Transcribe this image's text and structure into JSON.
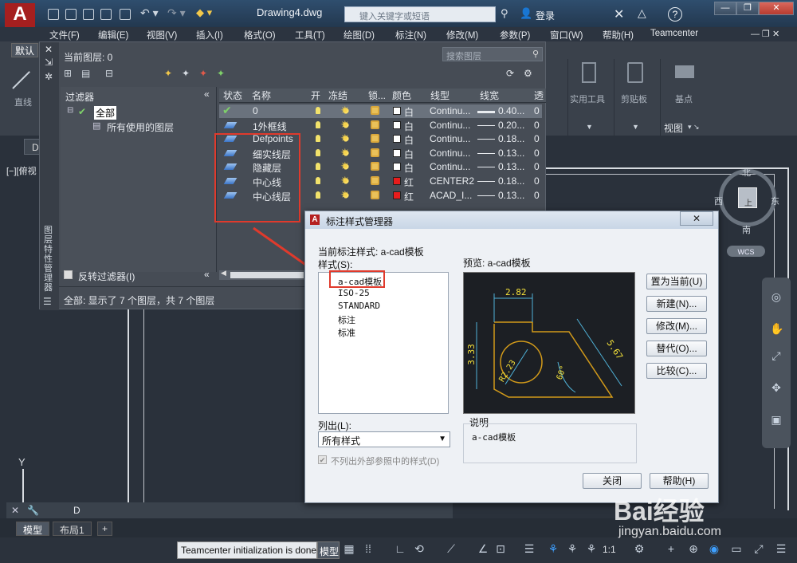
{
  "app": {
    "title": "Drawing4.dwg",
    "search_placeholder": "键入关键字或短语",
    "login": "登录",
    "help": "?"
  },
  "menu": [
    "文件(F)",
    "编辑(E)",
    "视图(V)",
    "插入(I)",
    "格式(O)",
    "工具(T)",
    "绘图(D)",
    "标注(N)",
    "修改(M)",
    "参数(P)",
    "窗口(W)",
    "帮助(H)",
    "Teamcenter"
  ],
  "ribbon": {
    "tab_default": "默认",
    "left_label": "直线",
    "panels": [
      "实用工具",
      "剪贴板",
      "基点"
    ],
    "view_label": "视图",
    "viewport_label": "[−][俯视",
    "d_tab": "D"
  },
  "layer_manager": {
    "current_layer": "当前图层: 0",
    "search_placeholder": "搜索图层",
    "filters_title": "过滤器",
    "filter_all": "全部",
    "filter_used": "所有使用的图层",
    "invert_filter": "反转过滤器(I)",
    "side_title": "图层特性管理器",
    "status_text": "全部: 显示了 7 个图层，共 7 个图层",
    "columns": [
      "状态",
      "名称",
      "开",
      "冻结",
      "锁...",
      "颜色",
      "线型",
      "线宽",
      "透"
    ],
    "rows": [
      {
        "name": "0",
        "color": "白",
        "color_hex": "#ffffff",
        "linetype": "Continu...",
        "lineweight": "0.40...",
        "trans": "0",
        "current": true
      },
      {
        "name": "1外框线",
        "color": "白",
        "color_hex": "#ffffff",
        "linetype": "Continu...",
        "lineweight": "0.20...",
        "trans": "0",
        "current": false
      },
      {
        "name": "Defpoints",
        "color": "白",
        "color_hex": "#ffffff",
        "linetype": "Continu...",
        "lineweight": "0.18...",
        "trans": "0",
        "current": false
      },
      {
        "name": "细实线层",
        "color": "白",
        "color_hex": "#ffffff",
        "linetype": "Continu...",
        "lineweight": "0.13...",
        "trans": "0",
        "current": false
      },
      {
        "name": "隐藏层",
        "color": "白",
        "color_hex": "#ffffff",
        "linetype": "Continu...",
        "lineweight": "0.13...",
        "trans": "0",
        "current": false
      },
      {
        "name": "中心线",
        "color": "红",
        "color_hex": "#e81c1c",
        "linetype": "CENTER2",
        "lineweight": "0.18...",
        "trans": "0",
        "current": false
      },
      {
        "name": "中心线层",
        "color": "红",
        "color_hex": "#e81c1c",
        "linetype": "ACAD_I...",
        "lineweight": "0.13...",
        "trans": "0",
        "current": false
      }
    ]
  },
  "dialog": {
    "title": "标注样式管理器",
    "current_style": "当前标注样式: a-cad模板",
    "styles_label": "样式(S):",
    "styles": [
      "a-cad模板",
      "ISO-25",
      "STANDARD",
      "标注",
      "标准"
    ],
    "preview_label": "预览: a-cad模板",
    "list_label": "列出(L):",
    "list_value": "所有样式",
    "checkbox_label": "不列出外部参照中的样式(D)",
    "desc_label": "说明",
    "desc_value": "a-cad模板",
    "buttons": [
      "置为当前(U)",
      "新建(N)...",
      "修改(M)...",
      "替代(O)...",
      "比较(C)..."
    ],
    "close": "关闭",
    "help": "帮助(H)",
    "preview_dims": {
      "top": "2.82",
      "left": "3.33",
      "right": "5.67",
      "radius": "R2.23",
      "angle": "60°"
    }
  },
  "compass": {
    "n": "北",
    "s": "南",
    "e": "东",
    "w": "西",
    "top": "上",
    "wcs": "WCS"
  },
  "axis_y": "Y",
  "command_prefix": "D",
  "layout_tabs": [
    "模型",
    "布局1",
    "+"
  ],
  "status": {
    "message": "Teamcenter initialization is done",
    "model": "模型",
    "scale": "1:1"
  },
  "watermark": {
    "brand": "Bai经验",
    "url": "jingyan.baidu.com"
  }
}
